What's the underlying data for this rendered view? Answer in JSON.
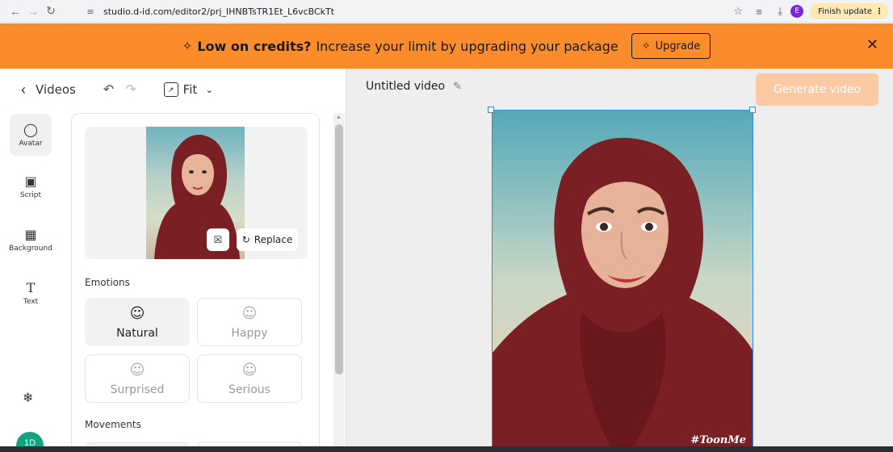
{
  "browser": {
    "url": "studio.d-id.com/editor2/prj_IHNBTsTR1Et_L6vcBCkTt",
    "profile_initial": "E",
    "finish_update_label": "Finish update"
  },
  "banner": {
    "bold_text": "Low on credits?",
    "text": "Increase your limit by upgrading your package",
    "upgrade_label": "Upgrade"
  },
  "toolbar": {
    "back_label": "Videos",
    "zoom_label": "Fit"
  },
  "rail": {
    "items": [
      {
        "label": "Avatar",
        "icon": "person-icon"
      },
      {
        "label": "Script",
        "icon": "chat-icon"
      },
      {
        "label": "Background",
        "icon": "hatch-icon"
      },
      {
        "label": "Text",
        "icon": "text-icon"
      }
    ],
    "user_initials": "1D"
  },
  "panel": {
    "replace_label": "Replace",
    "emotions_label": "Emotions",
    "emotions": [
      {
        "label": "Natural",
        "selected": true
      },
      {
        "label": "Happy",
        "selected": false
      },
      {
        "label": "Surprised",
        "selected": false
      },
      {
        "label": "Serious",
        "selected": false
      }
    ],
    "movements_label": "Movements"
  },
  "canvas": {
    "title": "Untitled video",
    "generate_label": "Generate video",
    "watermark": "#ToonMe"
  },
  "colors": {
    "banner": "#fb8c2c",
    "generate_disabled": "#fbc9a2",
    "selection": "#2d8ce8",
    "avatar_rail": "#14a37f"
  }
}
